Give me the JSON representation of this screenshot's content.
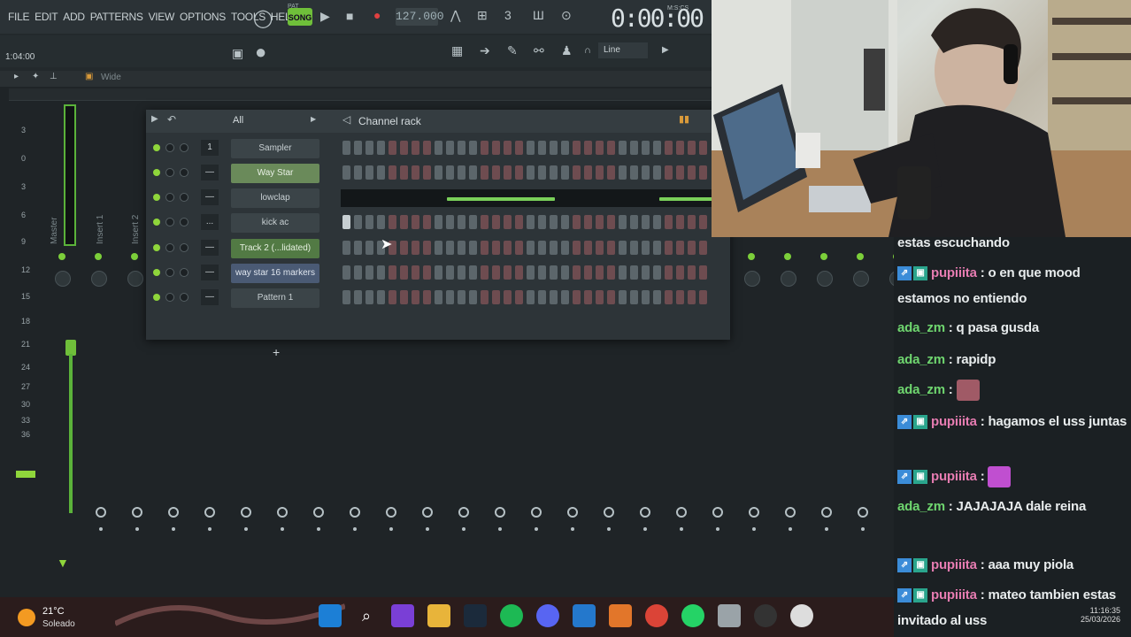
{
  "menu": [
    "FILE",
    "EDIT",
    "ADD",
    "PATTERNS",
    "VIEW",
    "OPTIONS",
    "TOOLS",
    "HELP"
  ],
  "transport": {
    "mode_pat": "PAT",
    "mode_song": "SONG",
    "bpm": "127.000",
    "time": "0:00:00",
    "time_unit": "M:S:CS"
  },
  "hint_bar": "1:04:00",
  "snap": "Line",
  "mixer": {
    "wide_label": "Wide",
    "master_label": "Master",
    "insert_labels": [
      "Insert 1",
      "Insert 2"
    ],
    "db_scale": [
      "3",
      "0",
      "3",
      "6",
      "9",
      "12",
      "15",
      "18",
      "21",
      "24",
      "27",
      "30",
      "33",
      "36"
    ]
  },
  "channel_rack": {
    "filter": "All",
    "title": "Channel rack",
    "channels": [
      {
        "num": "1",
        "name": "Sampler",
        "style": "plain"
      },
      {
        "num": "—",
        "name": "Way Star",
        "style": "sel"
      },
      {
        "num": "—",
        "name": "lowclap",
        "style": "plain"
      },
      {
        "num": "...",
        "name": "kick ac",
        "style": "plain"
      },
      {
        "num": "—",
        "name": "Track 2 (...lidated)",
        "style": "green"
      },
      {
        "num": "—",
        "name": "way star 16 markers",
        "style": "blue"
      },
      {
        "num": "—",
        "name": "Pattern 1",
        "style": "plain"
      }
    ],
    "add": "+"
  },
  "chat": [
    {
      "user": "",
      "text": "estas escuchando",
      "color": ""
    },
    {
      "user": "pupiiita",
      "text": ": o en que mood estamos no entiendo",
      "color": "pink",
      "badges": true
    },
    {
      "user": "ada_zm",
      "text": ": q pasa gusda",
      "color": "green"
    },
    {
      "user": "ada_zm",
      "text": ": rapidp",
      "color": "green"
    },
    {
      "user": "ada_zm",
      "text": ":",
      "color": "green",
      "emote": "#a05a66"
    },
    {
      "user": "pupiiita",
      "text": ": hagamos el uss juntas",
      "color": "pink",
      "badges": true
    },
    {
      "user": "pupiiita",
      "text": ":",
      "color": "pink",
      "badges": true,
      "emote": "#c04fd0"
    },
    {
      "user": "ada_zm",
      "text": ": JAJAJAJA dale reina",
      "color": "green"
    },
    {
      "user": "pupiiita",
      "text": ": aaa muy piola",
      "color": "pink",
      "badges": true
    },
    {
      "user": "pupiiita",
      "text": ": mateo tambien estas invitado al uss",
      "color": "pink",
      "badges": true
    }
  ],
  "taskbar": {
    "temp": "21°C",
    "condition": "Soleado",
    "time": "11:16:35",
    "date": "25/03/2026"
  },
  "colors": {
    "accent_green": "#7ccf3a",
    "chat_pink": "#e67cb1",
    "chat_green": "#6fd66f"
  }
}
